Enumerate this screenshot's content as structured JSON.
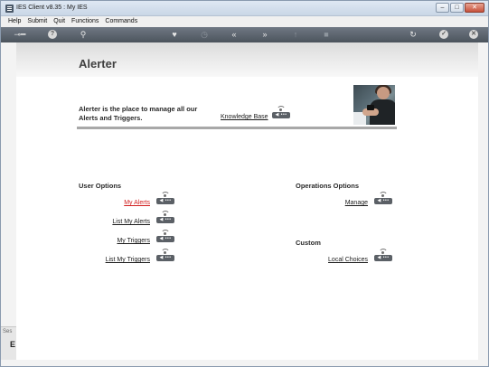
{
  "window": {
    "title": "IES Client v8.35 : My IES"
  },
  "menu": [
    "Help",
    "Submit",
    "Quit",
    "Functions",
    "Commands"
  ],
  "toolbar": {
    "help_label": "?",
    "icons": [
      "key-icon",
      "help-icon",
      "search-icon",
      "heart-icon",
      "clock-icon",
      "back-double-icon",
      "forward-double-icon",
      "upload-icon",
      "stop-icon",
      "refresh-icon",
      "confirm-icon",
      "close-icon"
    ]
  },
  "page": {
    "title": "Alerter",
    "intro": "Alerter is the place to manage all our Alerts and Triggers.",
    "knowledge_base": "Knowledge Base",
    "button_label": "◀ •••"
  },
  "user_options": {
    "title": "User Options",
    "links": [
      "My Alerts",
      "List My Alerts",
      "My Triggers",
      "List My Triggers"
    ]
  },
  "operations_options": {
    "title": "Operations Options",
    "links": [
      "Manage"
    ]
  },
  "custom": {
    "title": "Custom",
    "links": [
      "Local Choices"
    ]
  },
  "side_stub": {
    "text": "Ses",
    "letter": "E"
  },
  "colors": {
    "toolbar": "#5a626b",
    "link_active": "#d21f1f",
    "divider": "#a8a8a8"
  }
}
